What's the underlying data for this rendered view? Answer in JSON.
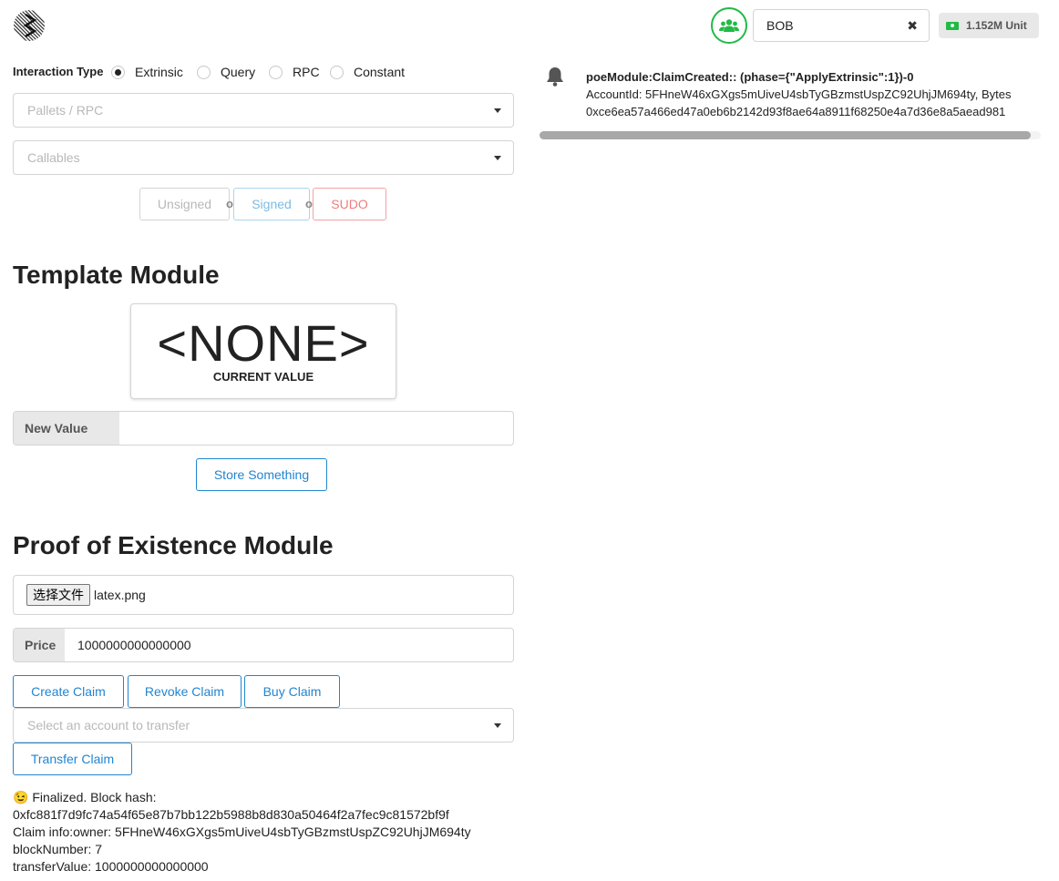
{
  "header": {
    "account_name": "BOB",
    "balance": "1.152M Unit",
    "icons": {
      "logo": "substrate-logo",
      "accounts": "users-icon",
      "clear": "close-icon",
      "money": "money-icon"
    }
  },
  "interaction": {
    "label": "Interaction Type",
    "options": [
      "Extrinsic",
      "Query",
      "RPC",
      "Constant"
    ],
    "selected": "Extrinsic",
    "pallets_placeholder": "Pallets / RPC",
    "callables_placeholder": "Callables",
    "buttons": {
      "unsigned": "Unsigned",
      "signed": "Signed",
      "sudo": "SUDO",
      "or": "or"
    }
  },
  "template_module": {
    "title": "Template Module",
    "current_value": "<NONE>",
    "current_value_label": "CURRENT VALUE",
    "new_value_label": "New Value",
    "new_value": "",
    "store_button": "Store Something"
  },
  "poe_module": {
    "title": "Proof of Existence Module",
    "file_button": "选择文件",
    "file_name": "latex.png",
    "price_label": "Price",
    "price_value": "1000000000000000",
    "buttons": {
      "create": "Create Claim",
      "revoke": "Revoke Claim",
      "buy": "Buy Claim",
      "transfer": "Transfer Claim"
    },
    "account_placeholder": "Select an account to transfer",
    "status": {
      "line1": "😉 Finalized. Block hash:",
      "line2": "0xfc881f7d9fc74a54f65e87b7bb122b5988b8d830a50464f2a7fec9c81572bf9f",
      "line3": "Claim info:owner: 5FHneW46xGXgs5mUiveU4sbTyGBzmstUspZC92UhjJM694ty",
      "line4": "blockNumber: 7",
      "line5": "transferValue: 1000000000000000"
    }
  },
  "events": {
    "icon": "bell-icon",
    "title": "poeModule:ClaimCreated:: (phase={\"ApplyExtrinsic\":1})-0",
    "line1": "AccountId: 5FHneW46xGXgs5mUiveU4sbTyGBzmstUspZC92UhjJM694ty, Bytes",
    "line2": "0xce6ea57a466ed47a0eb6b2142d93f8ae64a8911f68250e4a7d36e8a5aead981"
  }
}
